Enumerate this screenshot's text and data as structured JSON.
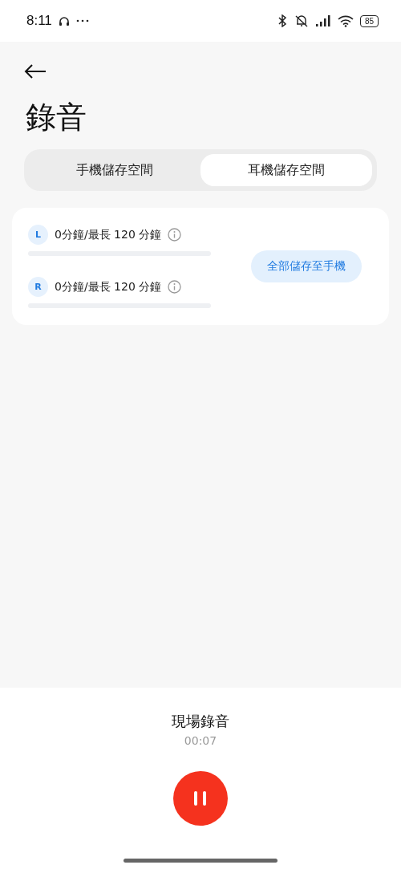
{
  "status_bar": {
    "time": "8:11",
    "battery": "85"
  },
  "title": "錄音",
  "tabs": [
    {
      "label": "手機儲存空間",
      "selected": false
    },
    {
      "label": "耳機儲存空間",
      "selected": true
    }
  ],
  "channels": [
    {
      "badge": "L",
      "usage": "0分鐘/最長 120 分鐘",
      "level": 0
    },
    {
      "badge": "R",
      "usage": "0分鐘/最長 120 分鐘",
      "level": 0
    }
  ],
  "save_all_button": "全部儲存至手機",
  "recording": {
    "title": "現場錄音",
    "elapsed": "00:07",
    "paused": false
  }
}
